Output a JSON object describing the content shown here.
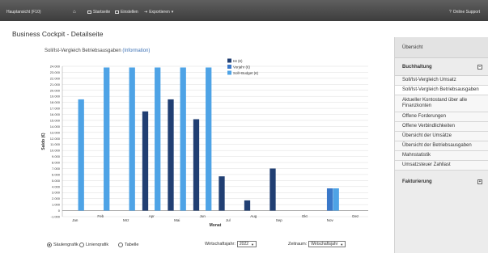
{
  "topbar": {
    "left_label": "Hauptansicht (F10)",
    "home_icon": "home-icon",
    "start_label": "Startseite",
    "uebersicht_label": "Einstellen",
    "export_label": "Exportieren",
    "support_label": "Online Support"
  },
  "page": {
    "title": "Business Cockpit - Detailseite",
    "subtitle": "Soll/Ist-Vergleich Betriebsausgaben",
    "subtitle_link": "(Information)"
  },
  "chart_data": {
    "type": "bar",
    "categories": [
      "Jan",
      "Feb",
      "Mrz",
      "Apr",
      "Mai",
      "Jun",
      "Jul",
      "Aug",
      "Sep",
      "Okt",
      "Nov",
      "Dez"
    ],
    "series": [
      {
        "name": "Ist (€)",
        "color": "#213f73",
        "values": [
          0,
          0,
          0,
          16500,
          18500,
          15200,
          5700,
          1700,
          7000,
          0,
          0,
          0
        ]
      },
      {
        "name": "Vorjahr (€)",
        "color": "#3a78c9",
        "values": [
          0,
          0,
          0,
          0,
          0,
          0,
          0,
          0,
          0,
          0,
          3700,
          0
        ]
      },
      {
        "name": "Soll+Budget (€)",
        "color": "#4ea3e6",
        "values": [
          18500,
          23800,
          23800,
          23800,
          23800,
          23800,
          0,
          0,
          0,
          0,
          3700,
          0
        ]
      }
    ],
    "xlabel": "Monat",
    "ylabel": "Saldo (€)",
    "ylim": [
      -1000,
      24000
    ],
    "yticks": [
      -1000,
      0,
      1000,
      2000,
      3000,
      4000,
      5000,
      6000,
      7000,
      8000,
      9000,
      10000,
      11000,
      12000,
      13000,
      14000,
      15000,
      16000,
      17000,
      18000,
      19000,
      20000,
      21000,
      22000,
      23000,
      24000
    ],
    "ytick_labels": [
      "-1.000",
      "0",
      "1.000",
      "2.000",
      "3.000",
      "4.000",
      "5.000",
      "6.000",
      "7.000",
      "8.000",
      "9.000",
      "10.000",
      "11.000",
      "12.000",
      "13.000",
      "14.000",
      "15.000",
      "16.000",
      "17.000",
      "18.000",
      "19.000",
      "20.000",
      "21.000",
      "22.000",
      "23.000",
      "24.000"
    ],
    "grid": true,
    "legend_position": "top"
  },
  "controls": {
    "radio_1": "Säulengrafik",
    "radio_2": "Linienqrafik",
    "radio_3": "Tabelle",
    "radio_selected": "Säulengrafik",
    "year_label": "Wirtschaftsjahr:",
    "year_value": "2022",
    "range_label": "Zeitraum:",
    "range_value": "Wirtschaftsjahr"
  },
  "sidebar": {
    "header": "Übersicht",
    "section_1": "Buchhaltung",
    "section_1_toggle": "−",
    "items": [
      "Soll/Ist-Vergleich Umsatz",
      "Soll/Ist-Vergleich Betriebsausgaben",
      "Aktueller Kontostand über alle Finanzkonten",
      "Offene Forderungen",
      "Offene Verbindlichkeiten",
      "Übersicht der Umsätze",
      "Übersicht der Betriebsausgaben",
      "Mahnstatistik",
      "Umsatzsteuer Zahllast"
    ],
    "active_index": 1,
    "section_2": "Fakturierung",
    "section_2_toggle": "+"
  }
}
